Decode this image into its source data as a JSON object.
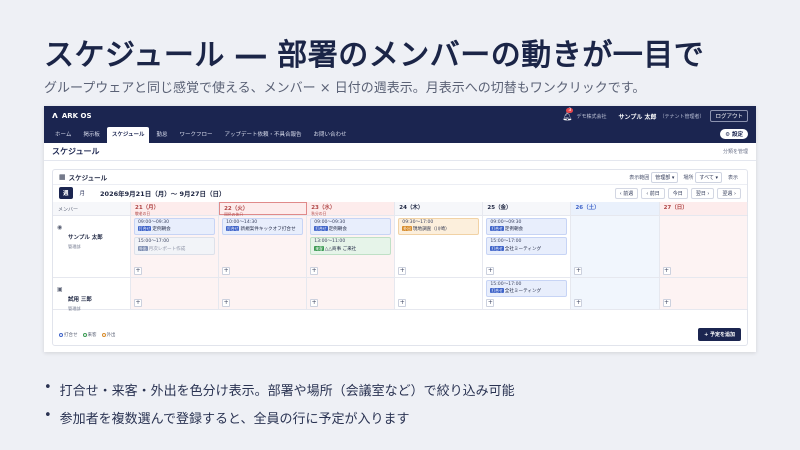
{
  "slide": {
    "title": "スケジュール ― 部署のメンバーの動きが一目で",
    "subtitle": "グループウェアと同じ感覚で使える、メンバー × 日付の週表示。月表示への切替もワンクリックです。",
    "bullets": [
      "打合せ・来客・外出を色分け表示。部署や場所（会議室など）で絞り込み可能",
      "参加者を複数選んで登録すると、全員の行に予定が入ります"
    ]
  },
  "app": {
    "logo": "ARK OS",
    "notification_count": "3",
    "company": "デモ株式会社",
    "user_name": "サンプル 太郎",
    "user_role": "（テナント管理者）",
    "logout": "ログアウト",
    "settings": "設定",
    "nav": [
      "ホーム",
      "掲示板",
      "スケジュール",
      "勤怠",
      "ワークフロー",
      "アップデート依頼・不具合報告",
      "お問い合わせ"
    ],
    "page_title": "スケジュール",
    "category_link": "分類を管理"
  },
  "calendar": {
    "card_title": "スケジュール",
    "filter_scope_label": "表示範囲",
    "filter_scope_value": "管理部",
    "filter_place_label": "場所",
    "filter_place_value": "すべて",
    "filter_show": "表示",
    "view_week": "週",
    "view_month": "月",
    "range": "2026年9月21日（月）〜 9月27日（日）",
    "nav_prev_week": "‹ 前週",
    "nav_prev_day": "‹ 前日",
    "nav_today": "今日",
    "nav_next_day": "翌日 ›",
    "nav_next_week": "翌週 ›",
    "member_header": "メンバー",
    "days": [
      {
        "label": "21（月）",
        "note": "敬老の日"
      },
      {
        "label": "22（火）",
        "note": "国民の休日"
      },
      {
        "label": "23（水）",
        "note": "秋分の日"
      },
      {
        "label": "24（木）",
        "note": ""
      },
      {
        "label": "25（金）",
        "note": ""
      },
      {
        "label": "26（土）",
        "note": ""
      },
      {
        "label": "27（日）",
        "note": ""
      }
    ],
    "members": [
      {
        "name": "サンプル 太郎",
        "dept": "管理部"
      },
      {
        "name": "試用 三郎",
        "dept": "管理部"
      }
    ],
    "events": {
      "e1": {
        "time": "09:00〜09:30",
        "tag": "打合せ",
        "title": "定例朝会"
      },
      "e2": {
        "time": "15:00〜17:00",
        "tag": "外出",
        "title": "月次レポート作成"
      },
      "e3": {
        "time": "10:00〜14:30",
        "tag": "打合せ",
        "title": "新規案件キックオフ打合せ"
      },
      "e4": {
        "time": "09:00〜09:30",
        "tag": "打合せ",
        "title": "定例朝会"
      },
      "e5": {
        "time": "13:00〜11:00",
        "tag": "来客",
        "title": "△△商事 ご来社"
      },
      "e6": {
        "time": "09:30〜17:00",
        "tag": "外出",
        "title": "現地調査（川崎）"
      },
      "e7": {
        "time": "09:00〜09:30",
        "tag": "打合せ",
        "title": "定例朝会"
      },
      "e8": {
        "time": "15:00〜17:00",
        "tag": "打合せ",
        "title": "全社ミーティング"
      },
      "e9": {
        "time": "15:00〜17:00",
        "tag": "打合せ",
        "title": "全社ミーティング"
      }
    },
    "legend": [
      "打合せ",
      "来客",
      "外出"
    ],
    "add_button": "+ 予定を追加"
  },
  "colors": {
    "navy": "#1b2550",
    "meeting": "#3e63c9",
    "visitor": "#3a9a52",
    "outing": "#d78b2a",
    "holiday_bg": "#fdecec",
    "saturday_bg": "#eaf1fc"
  }
}
